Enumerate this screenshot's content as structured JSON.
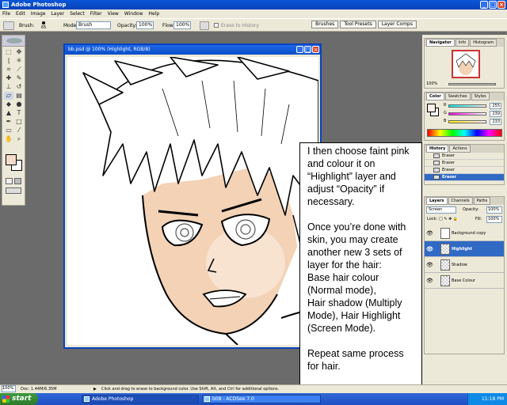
{
  "app": {
    "title": "Adobe Photoshop",
    "menu": [
      "File",
      "Edit",
      "Image",
      "Layer",
      "Select",
      "Filter",
      "View",
      "Window",
      "Help"
    ]
  },
  "options": {
    "brush_label": "Brush:",
    "brush_size": "65",
    "mode_label": "Mode:",
    "mode_value": "Brush",
    "opacity_label": "Opacity:",
    "opacity_value": "100%",
    "flow_label": "Flow:",
    "flow_value": "100%",
    "history_label": "Erase to History"
  },
  "panel_well": [
    "Brushes",
    "Tool Presets",
    "Layer Comps"
  ],
  "document": {
    "title": "bb.psd @ 100% (Highlight, RGB/8)"
  },
  "navigator": {
    "tabs": [
      "Navigator",
      "Info",
      "Histogram"
    ],
    "zoom": "100%"
  },
  "color": {
    "tabs": [
      "Color",
      "Swatches",
      "Styles"
    ],
    "channels": [
      {
        "label": "R",
        "value": "255"
      },
      {
        "label": "G",
        "value": "239"
      },
      {
        "label": "B",
        "value": "233"
      }
    ]
  },
  "history": {
    "tabs": [
      "History",
      "Actions"
    ],
    "items": [
      "Eraser",
      "Eraser",
      "Eraser",
      "Eraser"
    ],
    "selected_index": 3
  },
  "layers": {
    "tabs": [
      "Layers",
      "Channels",
      "Paths"
    ],
    "blend_mode": "Screen",
    "opacity_label": "Opacity:",
    "opacity": "100%",
    "lock_label": "Lock:",
    "fill_label": "Fill:",
    "fill": "100%",
    "items": [
      "Background copy",
      "Highlight",
      "Shadow",
      "Base Colour"
    ],
    "selected_index": 1
  },
  "note": {
    "text": "I then choose faint pink and colour it on “Highlight” layer and adjust “Opacity” if necessary.\n\nOnce you’re done with skin, you may create another new 3 sets of layer for the hair:\nBase hair colour (Normal mode),\nHair shadow (Multiply Mode), Hair Highlight (Screen Mode).\n\nRepeat same process for hair."
  },
  "status": {
    "zoom": "100%",
    "doc": "Doc: 1.44M/6.35M",
    "hint": "Click and drag to erase to background color. Use Shift, Alt, and Ctrl for additional options."
  },
  "taskbar": {
    "start": "start",
    "items": [
      "Adobe Photoshop",
      "b08 - ACDSee 7.0"
    ],
    "clock": "11:18 PM"
  },
  "colors": {
    "skin": "#f3d2b5",
    "selection": "#316ac5",
    "title_blue": "#0a56d8"
  }
}
